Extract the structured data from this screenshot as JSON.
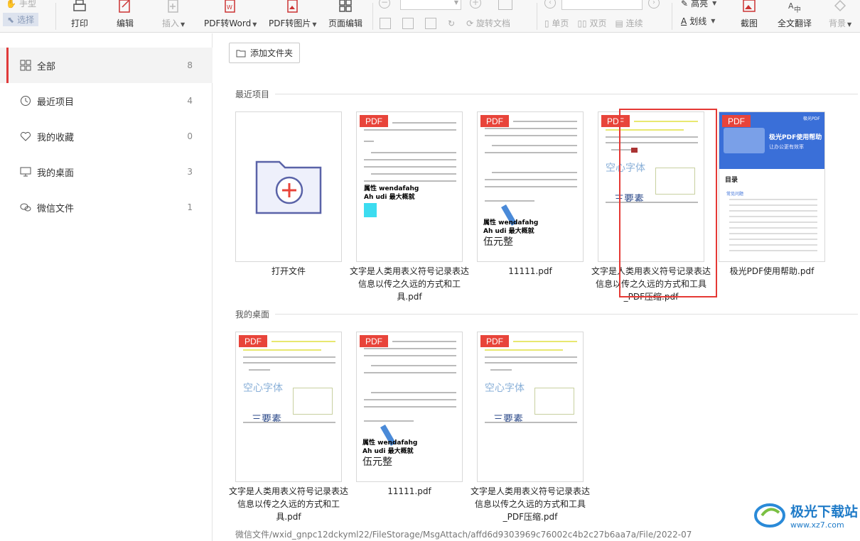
{
  "toolbar": {
    "hand": "手型",
    "select": "选择",
    "print": "打印",
    "edit": "编辑",
    "insert": "插入",
    "pdf2word": "PDF转Word",
    "pdf2img": "PDF转图片",
    "page_edit": "页面编辑",
    "rotate_doc": "旋转文档",
    "single": "单页",
    "double": "双页",
    "continuous": "连续",
    "highlight": "高亮",
    "underline": "划线",
    "screenshot": "截图",
    "translate": "全文翻译",
    "background": "背景"
  },
  "sidebar": {
    "items": [
      {
        "label": "全部",
        "count": "8"
      },
      {
        "label": "最近项目",
        "count": "4"
      },
      {
        "label": "我的收藏",
        "count": "0"
      },
      {
        "label": "我的桌面",
        "count": "3"
      },
      {
        "label": "微信文件",
        "count": "1"
      }
    ]
  },
  "main": {
    "add_folder": "添加文件夹",
    "sections": {
      "recent": "最近项目",
      "desktop": "我的桌面"
    },
    "badge": "PDF",
    "recent_files": [
      {
        "name": "打开文件"
      },
      {
        "name": "文字是人类用表义符号记录表达信息以传之久远的方式和工具.pdf"
      },
      {
        "name": "11111.pdf"
      },
      {
        "name": "文字是人类用表义符号记录表达信息以传之久远的方式和工具_PDF压缩.pdf"
      },
      {
        "name": "极光PDF使用帮助.pdf"
      }
    ],
    "desktop_files": [
      {
        "name": "文字是人类用表义符号记录表达信息以传之久远的方式和工具.pdf"
      },
      {
        "name": "11111.pdf"
      },
      {
        "name": "文字是人类用表义符号记录表达信息以传之久远的方式和工具_PDF压缩.pdf"
      }
    ],
    "thumb_text": {
      "attr": "属性 wendafahg",
      "ah": "Ah udi 最大概就",
      "wuyuan": "伍元整",
      "kongxin": "空心字体",
      "sanyao": "三要素",
      "help_title": "极光PDF使用帮助",
      "help_sub": "让办公更有效率",
      "mulu": "目录",
      "faq": "常见问题",
      "jiguang": "极光PDF"
    },
    "path": "微信文件/wxid_gnpc12dckyml22/FileStorage/MsgAttach/affd6d9303969c76002c4b2c27b6aa7a/File/2022-07"
  },
  "watermark": {
    "name": "极光下载站",
    "url": "www.xz7.com"
  },
  "colors": {
    "accent": "#e03a3a",
    "pdf_badge": "#e8443a",
    "help_banner": "#3a6fd8"
  }
}
